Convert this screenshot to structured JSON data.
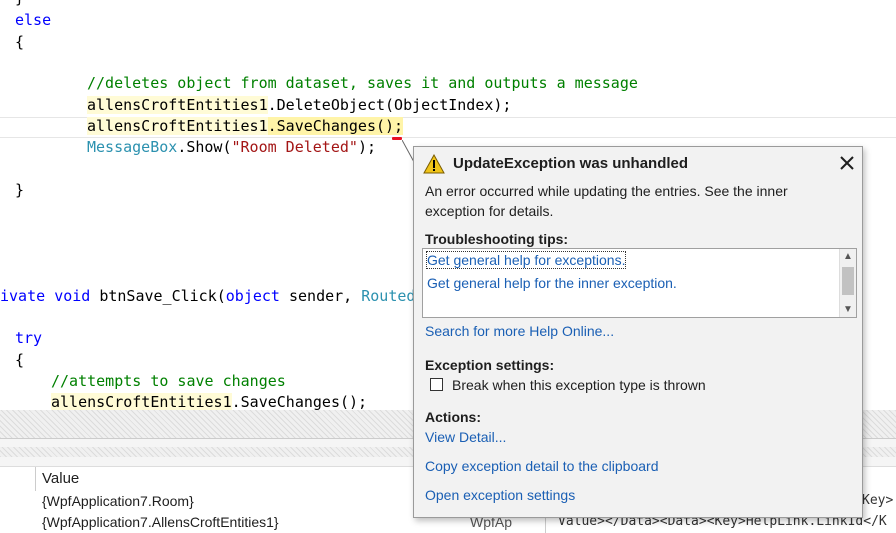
{
  "code": {
    "line_brace_top": "}",
    "line_else": "else",
    "line_open": "{",
    "comment_delete": "//deletes object from dataset, saves it and outputs a message",
    "delete_obj": "allensCroftEntities1",
    "delete_call": ".DeleteObject(ObjectIndex);",
    "save_obj": "allensCroftEntities1",
    "save_call": ".SaveChanges();",
    "msg_type": "MessageBox",
    "msg_call": ".Show(",
    "msg_str": "\"Room Deleted\"",
    "msg_end": ");",
    "line_close": "}",
    "btn_prefix": "ivate ",
    "btn_void": "void",
    "btn_name": " btnSave_Click(",
    "btn_object": "object",
    "btn_rest": " sender, ",
    "btn_routed": "Routed",
    "try_kw": "try",
    "try_open": "{",
    "comment_attempt": "//attempts to save changes",
    "save2_obj": "allensCroftEntities1",
    "save2_call": ".SaveChanges();"
  },
  "popup": {
    "title": "UpdateException was unhandled",
    "message_line1": "An error occurred while updating the entries. See the inner",
    "message_line2": "exception for details.",
    "tips_heading": "Troubleshooting tips:",
    "tips": [
      "Get general help for exceptions.",
      "Get general help for the inner exception."
    ],
    "search_link": "Search for more Help Online...",
    "settings_heading": "Exception settings:",
    "break_label": "Break when this exception type is thrown",
    "actions_heading": "Actions:",
    "actions": [
      "View Detail...",
      "Copy exception detail to the clipboard",
      "Open exception settings"
    ]
  },
  "watch": {
    "column_value": "Value",
    "rows": [
      {
        "value": "{WpfApplication7.Room}",
        "type": "",
        "extra": "Key>"
      },
      {
        "value": "{WpfApplication7.AllensCroftEntities1}",
        "type": "WpfAp",
        "extra": "Value></Data><Data><Key>HelpLink.LinkId</K"
      }
    ]
  },
  "icons": {
    "warning": "warning-icon",
    "close": "close-icon"
  },
  "colors": {
    "keyword": "#0000ff",
    "comment": "#008000",
    "string": "#a31515",
    "type": "#2b91af",
    "link": "#1a5fb4",
    "highlight": "#fff4a8"
  }
}
